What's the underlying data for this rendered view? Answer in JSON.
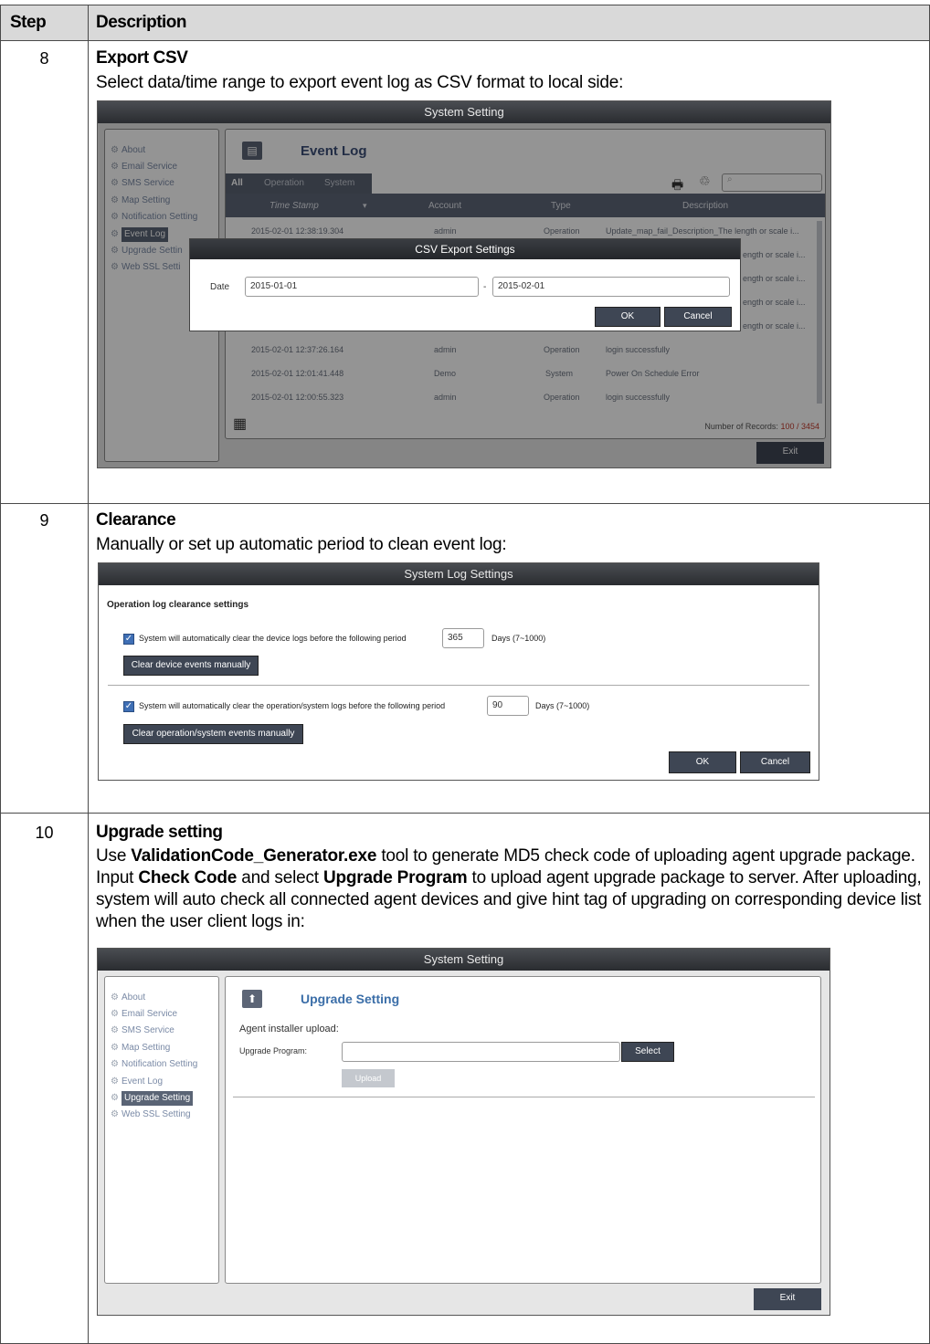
{
  "table": {
    "col_step": "Step",
    "col_description": "Description"
  },
  "rows": [
    {
      "step": "8",
      "title": "Export CSV",
      "text": "Select data/time range to export event log as CSV format to local side:",
      "screenshot": {
        "window_title": "System Setting",
        "sidebar": [
          "About",
          "Email Service",
          "SMS Service",
          "Map Setting",
          "Notification Setting",
          "Event Log",
          "Upgrade Settin",
          "Web SSL Setti"
        ],
        "heading": "Event Log",
        "tabs": [
          "All",
          "Operation",
          "System"
        ],
        "columns": [
          "Time Stamp",
          "Account",
          "Type",
          "Description"
        ],
        "grid_rows": [
          {
            "ts": "2015-02-01 12:38:19.304",
            "account": "admin",
            "type": "Operation",
            "desc": "Update_map_fail_Description_The length or scale i..."
          },
          {
            "ts": "",
            "account": "",
            "type": "",
            "desc": "ength or scale i..."
          },
          {
            "ts": "",
            "account": "",
            "type": "",
            "desc": "ength or scale i..."
          },
          {
            "ts": "",
            "account": "",
            "type": "",
            "desc": "ength or scale i..."
          },
          {
            "ts": "",
            "account": "",
            "type": "",
            "desc": "ength or scale i..."
          },
          {
            "ts": "2015-02-01 12:37:26.164",
            "account": "admin",
            "type": "Operation",
            "desc": "login successfully"
          },
          {
            "ts": "2015-02-01 12:01:41.448",
            "account": "Demo",
            "type": "System",
            "desc": "Power On Schedule Error"
          },
          {
            "ts": "2015-02-01 12:00:55.323",
            "account": "admin",
            "type": "Operation",
            "desc": "login successfully"
          }
        ],
        "records_label": "Number of Records:",
        "records_value": "100 / 3454",
        "exit": "Exit",
        "dialog": {
          "title": "CSV Export Settings",
          "date_label": "Date",
          "from": "2015-01-01",
          "separator": "-",
          "to": "2015-02-01",
          "ok": "OK",
          "cancel": "Cancel"
        }
      }
    },
    {
      "step": "9",
      "title": "Clearance",
      "text": "Manually or set up automatic period to clean event log:",
      "screenshot": {
        "window_title": "System Log Settings",
        "section": "Operation log clearance settings",
        "device_text": "System will automatically clear the device logs before the following period",
        "device_days": "365",
        "device_range": "Days (7~1000)",
        "device_button": "Clear device events manually",
        "op_text": "System will automatically clear the operation/system logs before the following period",
        "op_days": "90",
        "op_range": "Days (7~1000)",
        "op_button": "Clear operation/system events manually",
        "ok": "OK",
        "cancel": "Cancel"
      }
    },
    {
      "step": "10",
      "title": "Upgrade setting",
      "text_parts": [
        "Use ",
        "ValidationCode_Generator.exe",
        " tool to generate MD5 check code of uploading agent upgrade package. Input ",
        "Check Code",
        " and select ",
        "Upgrade Program",
        " to upload agent upgrade package to server. After uploading, system will auto check all connected agent devices and give hint tag of upgrading on corresponding device list when the user client logs in:"
      ],
      "screenshot": {
        "window_title": "System Setting",
        "sidebar": [
          "About",
          "Email Service",
          "SMS Service",
          "Map Setting",
          "Notification Setting",
          "Event Log",
          "Upgrade Setting",
          "Web SSL Setting"
        ],
        "heading": "Upgrade Setting",
        "subheading": "Agent installer upload:",
        "program_label": "Upgrade Program:",
        "select": "Select",
        "upload": "Upload",
        "exit": "Exit"
      }
    }
  ],
  "colors": {
    "header_bg": "#d9d9d9",
    "titlebar": "#2f3236",
    "accent_blue": "#3f6fb5",
    "button_dark": "#3e4654"
  }
}
